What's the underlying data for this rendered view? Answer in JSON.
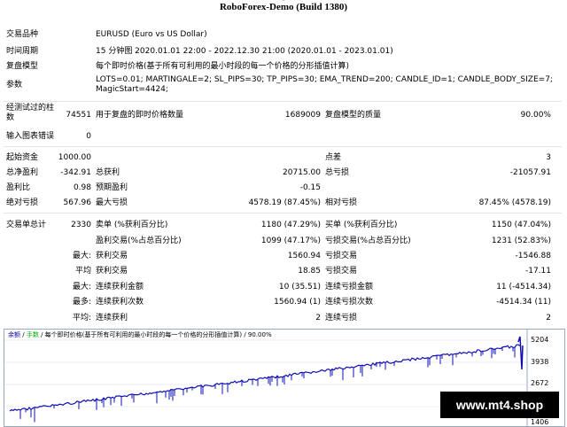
{
  "header": {
    "top_text": "[",
    "title": "RoboForex-Demo (Build 1380)"
  },
  "info": [
    {
      "label": "交易品种",
      "value": "EURUSD (Euro vs US Dollar)"
    },
    {
      "label": "时间周期",
      "value": "15 分钟图 2020.01.01 22:00 - 2022.12.30 21:00 (2020.01.01 - 2023.01.01)"
    },
    {
      "label": "复盘模型",
      "value": "每个即时价格(基于所有可利用的最小时段的每一个价格的分形插值计算)"
    },
    {
      "label": "参数",
      "value": "LOTS=0.01; MARTINGALE=2; SL_PIPS=30; TP_PIPS=30; EMA_TREND=200; CANDLE_ID=1; CANDLE_BODY_SIZE=7;",
      "value2": "MagicStart=4424;"
    }
  ],
  "bars": {
    "label1": "经测试过的柱",
    "label2": "数",
    "value": "74551",
    "ticks_label": "用于复盘的即时价格数量",
    "ticks_value": "1689009",
    "quality_label": "复盘模型的质量",
    "quality_value": "90.00%"
  },
  "mismatch": {
    "label": "输入图表错误",
    "value": "0"
  },
  "stats": {
    "initial_deposit_label": "起始资金",
    "initial_deposit": "1000.00",
    "spread_label": "点差",
    "spread": "3",
    "net_profit_label": "总净盈利",
    "net_profit": "-342.91",
    "gross_profit_label": "总获利",
    "gross_profit": "20715.00",
    "gross_loss_label": "总亏损",
    "gross_loss": "-21057.91",
    "profit_factor_label": "盈利比",
    "profit_factor": "0.98",
    "expected_payoff_label": "预期盈利",
    "expected_payoff": "-0.15",
    "abs_dd_label": "绝对亏损",
    "abs_dd": "567.96",
    "max_dd_label": "最大亏损",
    "max_dd": "4578.19 (87.45%)",
    "rel_dd_label": "相对亏损",
    "rel_dd": "87.45% (4578.19)"
  },
  "trades": {
    "total_label": "交易单总计",
    "total": "2330",
    "short_label": "卖单 (%获利百分比)",
    "short": "1180 (47.29%)",
    "long_label": "买单 (%获利百分比)",
    "long": "1150 (47.04%)",
    "won_label": "盈利交易(%占总百分比)",
    "won": "1099 (47.17%)",
    "lost_label": "亏损交易(%占总百分比)",
    "lost": "1231 (52.83%)",
    "rows": [
      {
        "k": "最大:",
        "a_label": "获利交易",
        "a": "1560.94",
        "b_label": "亏损交易",
        "b": "-1546.88"
      },
      {
        "k": "平均",
        "a_label": "获利交易",
        "a": "18.85",
        "b_label": "亏损交易",
        "b": "-17.11"
      },
      {
        "k": "最大:",
        "a_label": "连续获利金额",
        "a": "10 (35.51)",
        "b_label": "连续亏损金额",
        "b": "11 (-4514.34)"
      },
      {
        "k": "最多:",
        "a_label": "连续获利次数",
        "a": "1560.94 (1)",
        "b_label": "连续亏损次数",
        "b": "-4514.34 (11)"
      },
      {
        "k": "平均:",
        "a_label": "连续获利",
        "a": "2",
        "b_label": "连续亏损",
        "b": "2"
      }
    ]
  },
  "chart": {
    "head_balance": "余额",
    "head_sep": "/",
    "head_lots": "手数",
    "head_rest": "/ 每个即时价格(基于所有可利用的最小时段的每一个价格的分形插值计算) / 90.00%",
    "y_labels": [
      "5204",
      "3938",
      "2672",
      "1406"
    ],
    "line_color": "#1010b0"
  },
  "watermark": "www.mt4.shop"
}
